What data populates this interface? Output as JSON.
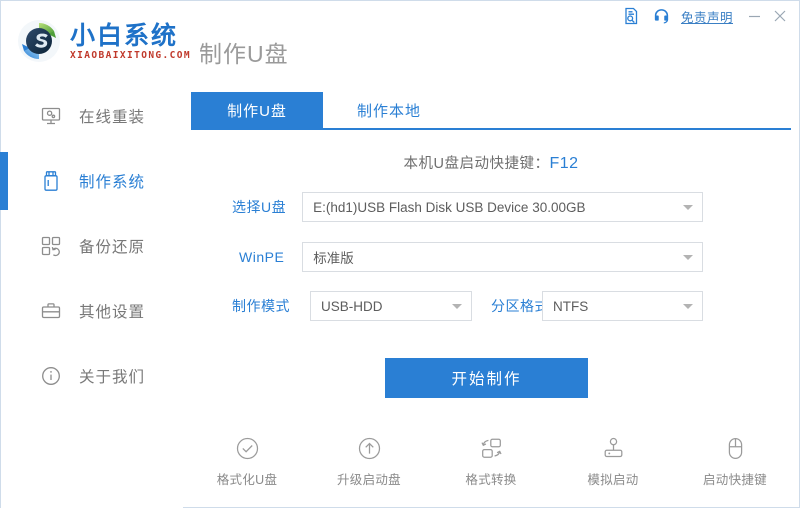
{
  "window": {
    "title": "小白系统",
    "logo_title": "小白系统",
    "logo_subtitle": "XIAOBAIXITONG.COM",
    "page_title": "制作U盘",
    "log_icon": "document-search-icon",
    "support_icon": "headset-icon",
    "disclaimer_label": "免责声明",
    "minimize_label": "minimize-icon",
    "close_label": "close-icon",
    "accent_color": "#2a7fd4",
    "logo_brand_color": "#1f72c8",
    "logo_sub_color": "#c0392b"
  },
  "sidebar": {
    "items": [
      {
        "label": "在线重装",
        "icon": "monitor-settings-icon",
        "active": false
      },
      {
        "label": "制作系统",
        "icon": "usb-drive-icon",
        "active": true
      },
      {
        "label": "备份还原",
        "icon": "grid-restore-icon",
        "active": false
      },
      {
        "label": "其他设置",
        "icon": "toolbox-icon",
        "active": false
      },
      {
        "label": "关于我们",
        "icon": "info-circle-icon",
        "active": false
      }
    ]
  },
  "main": {
    "tabs": [
      {
        "label": "制作U盘",
        "active": true
      },
      {
        "label": "制作本地",
        "active": false
      }
    ],
    "hotkey_prefix": "本机U盘启动快捷键：",
    "hotkey_value": "F12",
    "fields": {
      "usb": {
        "label": "选择U盘",
        "value": "E:(hd1)USB Flash Disk USB Device 30.00GB",
        "caret": "chevron-down-icon"
      },
      "winpe": {
        "label": "WinPE",
        "value": "标准版",
        "caret": "chevron-down-icon"
      },
      "mode": {
        "label": "制作模式",
        "value": "USB-HDD",
        "caret": "chevron-down-icon"
      },
      "partition": {
        "label": "分区格式",
        "value": "NTFS",
        "caret": "chevron-down-icon"
      }
    },
    "start_button_label": "开始制作"
  },
  "tools": [
    {
      "label": "格式化U盘",
      "icon": "check-circle-icon"
    },
    {
      "label": "升级启动盘",
      "icon": "arrow-up-circle-icon"
    },
    {
      "label": "格式转换",
      "icon": "convert-format-icon"
    },
    {
      "label": "模拟启动",
      "icon": "joystick-icon"
    },
    {
      "label": "启动快捷键",
      "icon": "mouse-icon"
    }
  ]
}
